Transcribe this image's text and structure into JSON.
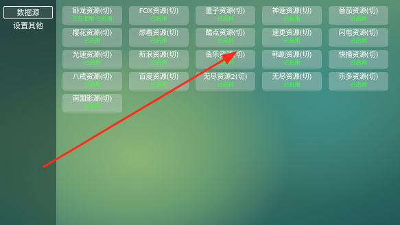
{
  "sidebar": {
    "items": [
      {
        "label": "数据源",
        "active": true
      },
      {
        "label": "设置其他",
        "active": false
      }
    ]
  },
  "sources": [
    {
      "name": "卧龙资源(切)",
      "status": "正在使用·已启用"
    },
    {
      "name": "FOX资源(切)",
      "status": "已启用"
    },
    {
      "name": "量子资源(切)",
      "status": "已启用"
    },
    {
      "name": "神速资源(切)",
      "status": "已启用"
    },
    {
      "name": "番茄资源(切)",
      "status": "已启用"
    },
    {
      "name": "樱花资源(切)",
      "status": "已启用"
    },
    {
      "name": "想看资源(切)",
      "status": "已启用"
    },
    {
      "name": "酷点资源(切)",
      "status": "已启用"
    },
    {
      "name": "速更资源(切)",
      "status": "已启用"
    },
    {
      "name": "闪电资源(切)",
      "status": "已启用"
    },
    {
      "name": "光速资源(切)",
      "status": "已启用"
    },
    {
      "name": "新浪资源(切)",
      "status": "已启用"
    },
    {
      "name": "鱼乐资源(切)",
      "status": "已启用"
    },
    {
      "name": "韩剧资源(切)",
      "status": "已启用"
    },
    {
      "name": "快播资源(切)",
      "status": "已启用"
    },
    {
      "name": "八戒资源(切)",
      "status": "已启用"
    },
    {
      "name": "百度资源(切)",
      "status": "已启用"
    },
    {
      "name": "无尽资源2(切)",
      "status": "已启用"
    },
    {
      "name": "无尽资源(切)",
      "status": "已启用"
    },
    {
      "name": "乐多资源(切)",
      "status": "已启用"
    },
    {
      "name": "南国影源(切)",
      "status": "已启用"
    }
  ],
  "annotation": {
    "color": "#ff2a1a"
  }
}
